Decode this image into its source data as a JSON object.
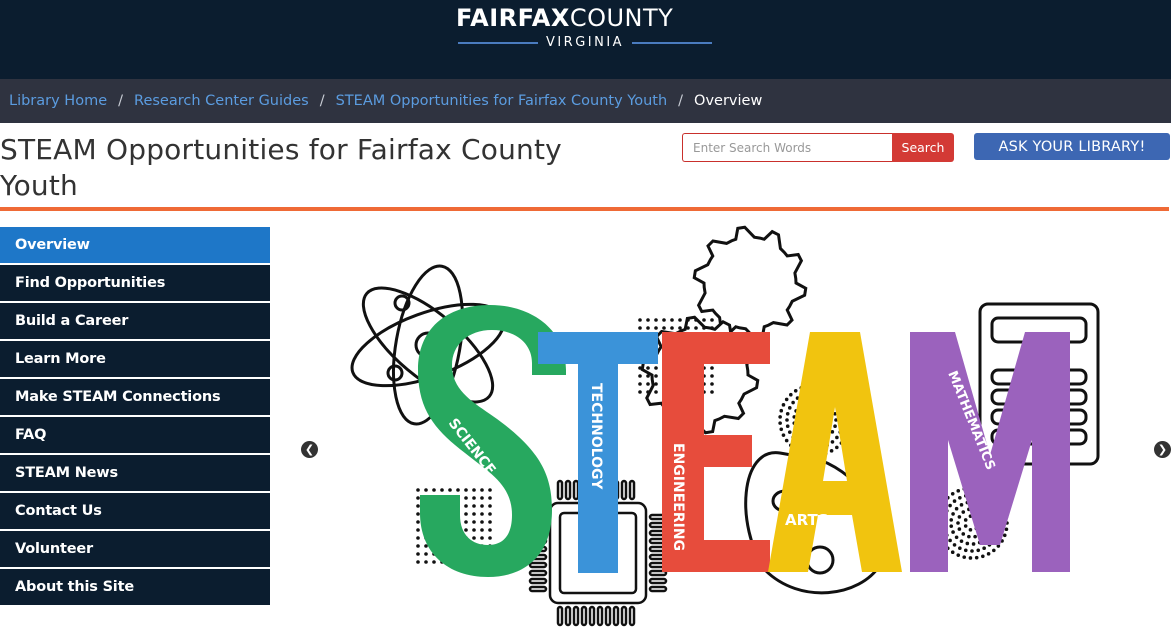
{
  "header": {
    "logo_bold": "FAIRFAX",
    "logo_light": "COUNTY",
    "logo_sub": "VIRGINIA"
  },
  "breadcrumb": {
    "items": [
      {
        "label": "Library Home"
      },
      {
        "label": "Research Center Guides"
      },
      {
        "label": "STEAM Opportunities for Fairfax County Youth"
      }
    ],
    "separator": "/",
    "current": "Overview"
  },
  "page": {
    "title": "STEAM Opportunities for Fairfax County Youth"
  },
  "search": {
    "placeholder": "Enter Search Words",
    "value": "",
    "button_label": "Search"
  },
  "ask_button": {
    "label": "ASK YOUR LIBRARY!"
  },
  "side_nav": {
    "items": [
      {
        "label": "Overview",
        "active": true
      },
      {
        "label": "Find Opportunities"
      },
      {
        "label": "Build a Career"
      },
      {
        "label": "Learn More"
      },
      {
        "label": "Make STEAM Connections"
      },
      {
        "label": "FAQ"
      },
      {
        "label": "STEAM News"
      },
      {
        "label": "Contact Us"
      },
      {
        "label": "Volunteer"
      },
      {
        "label": "About this Site"
      }
    ]
  },
  "carousel": {
    "prev_icon": "chevron-left-icon",
    "next_icon": "chevron-right-icon",
    "slide": {
      "letters": [
        "S",
        "T",
        "E",
        "A",
        "M"
      ],
      "labels": [
        "SCIENCE",
        "TECHNOLOGY",
        "ENGINEERING",
        "ARTS",
        "MATHEMATICS"
      ],
      "colors": {
        "science": "#27a85f",
        "technology": "#3b93d9",
        "engineering": "#e74c3c",
        "arts": "#f1c40f",
        "mathematics": "#9b62bd"
      }
    }
  },
  "colors": {
    "header_bg": "#0b1d2f",
    "breadcrumb_bg": "#2f3340",
    "link": "#5b9ce0",
    "accent_orange": "#ef6a36",
    "nav_active": "#1e77c8",
    "search_red": "#d33a35",
    "ask_blue": "#3d67b3"
  }
}
